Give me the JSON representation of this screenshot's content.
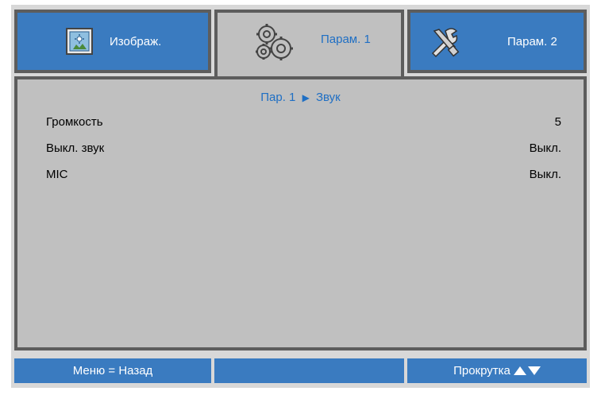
{
  "tabs": [
    {
      "label": "Изображ.",
      "icon": "image-settings-icon"
    },
    {
      "label": "Парам. 1",
      "icon": "gears-icon"
    },
    {
      "label": "Парам. 2",
      "icon": "tools-icon"
    }
  ],
  "breadcrumb": {
    "parent": "Пар. 1",
    "separator": "▶",
    "current": "Звук"
  },
  "settings": [
    {
      "label": "Громкость",
      "value": "5"
    },
    {
      "label": "Выкл. звук",
      "value": "Выкл."
    },
    {
      "label": "MIC",
      "value": "Выкл."
    }
  ],
  "footer": {
    "back_hint": "Меню = Назад",
    "middle": "",
    "scroll_hint": "Прокрутка"
  },
  "colors": {
    "tab_blue": "#3a7bc0",
    "panel_gray": "#c0c0c0",
    "accent_text": "#1f6fc4",
    "border": "#5d5d5d"
  }
}
